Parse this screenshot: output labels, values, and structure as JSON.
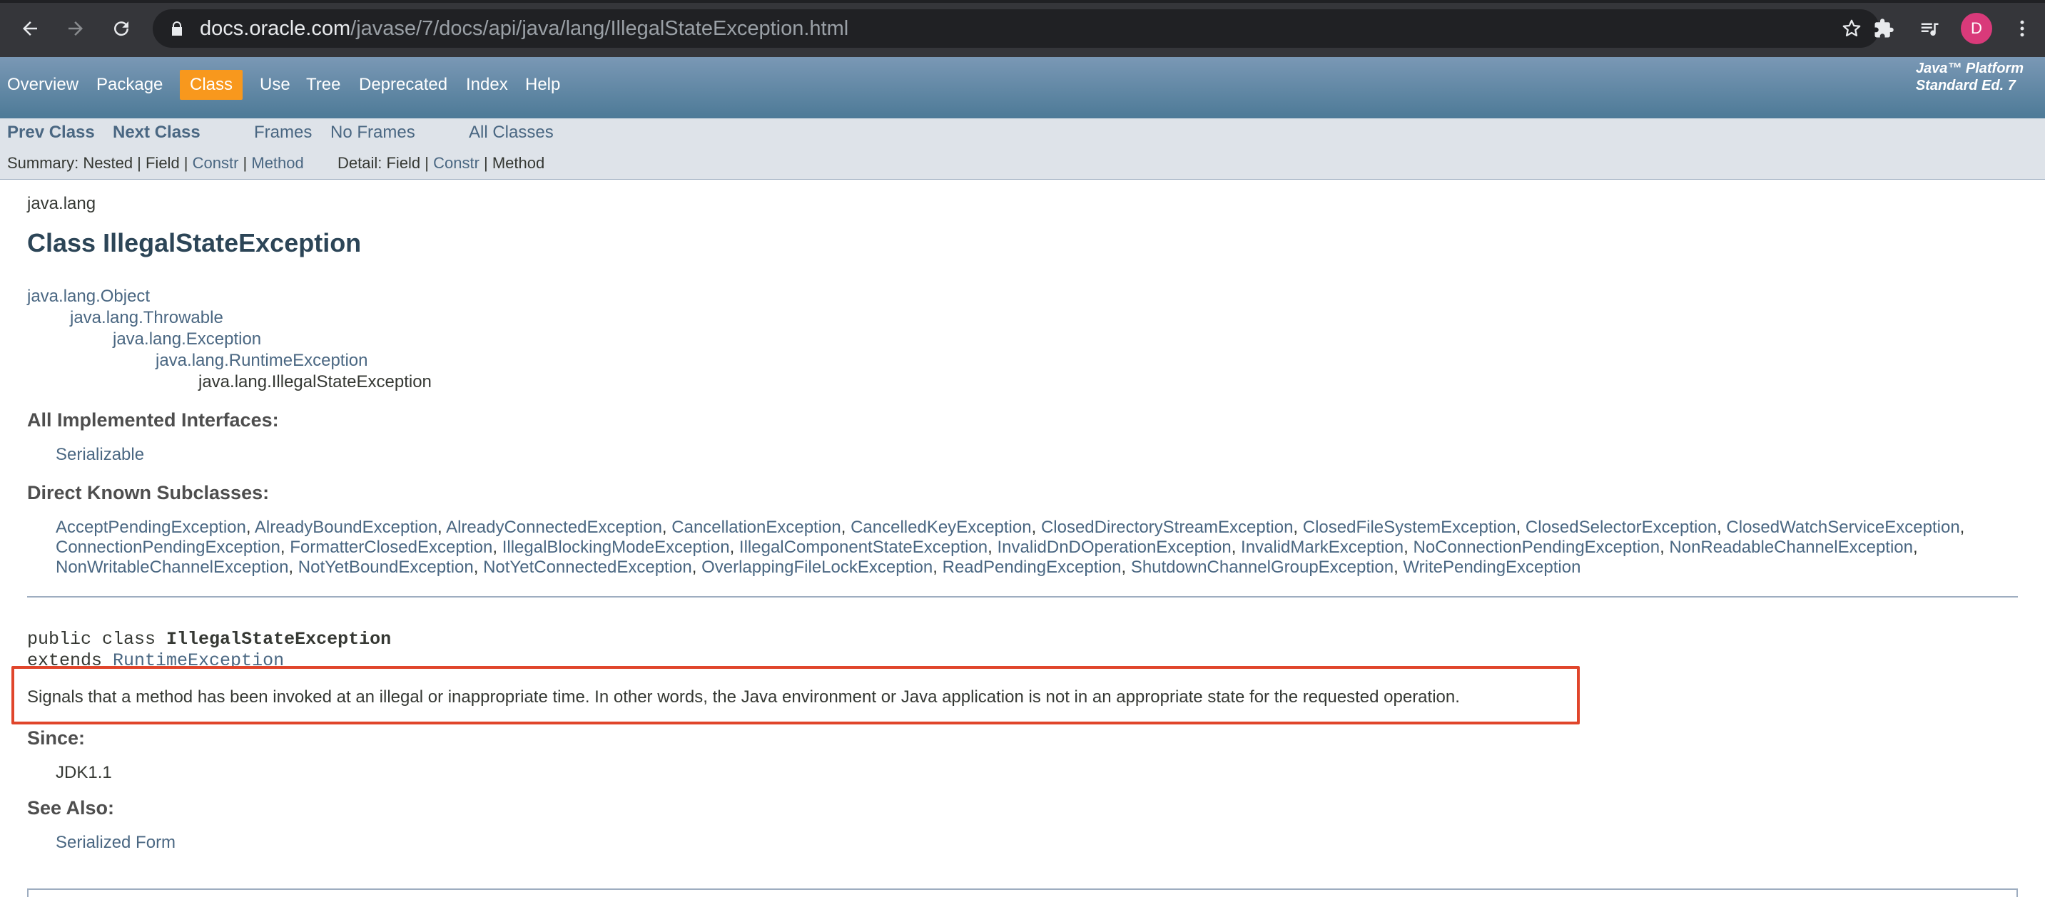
{
  "browser": {
    "url_host": "docs.oracle.com",
    "url_path": "/javase/7/docs/api/java/lang/IllegalStateException.html",
    "avatar_letter": "D",
    "icons": [
      "back-arrow-icon",
      "forward-arrow-icon",
      "reload-icon",
      "lock-icon",
      "star-icon",
      "extensions-puzzle-icon",
      "media-queue-icon",
      "kebab-menu-icon"
    ]
  },
  "topnav": {
    "items": [
      "Overview",
      "Package",
      "Class",
      "Use",
      "Tree",
      "Deprecated",
      "Index",
      "Help"
    ],
    "active": "Class",
    "about_line1": "Java™ Platform",
    "about_line2": "Standard Ed. 7"
  },
  "subnav": {
    "prev_class": "Prev Class",
    "next_class": "Next Class",
    "frames": "Frames",
    "no_frames": "No Frames",
    "all_classes": "All Classes",
    "summary_prefix": "Summary: Nested | Field | ",
    "summary_constr": "Constr",
    "summary_sep": " | ",
    "summary_method": "Method",
    "detail_prefix": "Detail: Field | ",
    "detail_constr": "Constr",
    "detail_sep": " | Method"
  },
  "content": {
    "package": "java.lang",
    "title": "Class IllegalStateException",
    "inheritance": [
      "java.lang.Object",
      "java.lang.Throwable",
      "java.lang.Exception",
      "java.lang.RuntimeException",
      "java.lang.IllegalStateException"
    ],
    "interfaces_label": "All Implemented Interfaces:",
    "interfaces": [
      "Serializable"
    ],
    "subclasses_label": "Direct Known Subclasses:",
    "subclasses": [
      "AcceptPendingException",
      "AlreadyBoundException",
      "AlreadyConnectedException",
      "CancellationException",
      "CancelledKeyException",
      "ClosedDirectoryStreamException",
      "ClosedFileSystemException",
      "ClosedSelectorException",
      "ClosedWatchServiceException",
      "ConnectionPendingException",
      "FormatterClosedException",
      "IllegalBlockingModeException",
      "IllegalComponentStateException",
      "InvalidDnDOperationException",
      "InvalidMarkException",
      "NoConnectionPendingException",
      "NonReadableChannelException",
      "NonWritableChannelException",
      "NotYetBoundException",
      "NotYetConnectedException",
      "OverlappingFileLockException",
      "ReadPendingException",
      "ShutdownChannelGroupException",
      "WritePendingException"
    ],
    "decl_prefix": "public class ",
    "decl_name": "IllegalStateException",
    "extends_prefix": "extends ",
    "extends_name": "RuntimeException",
    "description": "Signals that a method has been invoked at an illegal or inappropriate time. In other words, the Java environment or Java application is not in an appropriate state for the requested operation.",
    "since_label": "Since:",
    "since_value": "JDK1.1",
    "see_also_label": "See Also:",
    "see_also": [
      "Serialized Form"
    ]
  },
  "colors": {
    "link": "#4a6782",
    "active_tab": "#f8981d",
    "highlight_box": "#e0452b",
    "nav_bar": "#4d7a97"
  }
}
